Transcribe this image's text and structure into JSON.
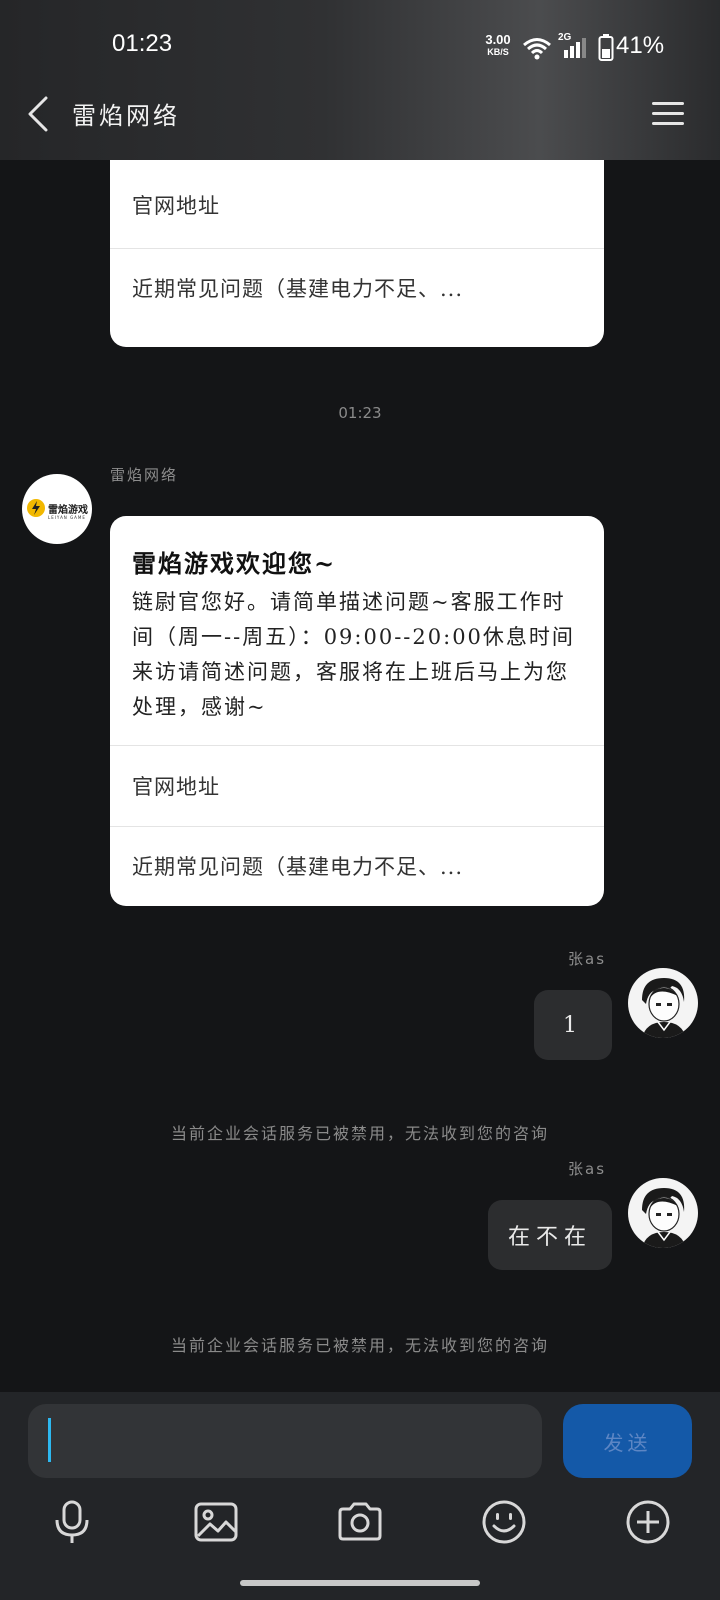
{
  "status_bar": {
    "time": "01:23",
    "net_speed": "3.00",
    "net_unit": "KB/S",
    "signal_label": "2G",
    "battery": "41%"
  },
  "header": {
    "title": "雷焰网络"
  },
  "chat": {
    "card_partial": {
      "link1": "官网地址",
      "link2": "近期常见问题（基建电力不足、..."
    },
    "timestamp": "01:23",
    "bot": {
      "name": "雷焰网络",
      "avatar_text": "雷焰游戏",
      "avatar_sub": "LEIYAN GAME",
      "card": {
        "heading": "雷焰游戏欢迎您~",
        "body": "链尉官您好。请简单描述问题~客服工作时间（周一--周五）：09:00--20:00休息时间来访请简述问题，客服将在上班后马上为您处理，感谢~",
        "link1": "官网地址",
        "link2": "近期常见问题（基建电力不足、..."
      }
    },
    "messages": [
      {
        "sender": "张as",
        "text": "1",
        "notice": "当前企业会话服务已被禁用，无法收到您的咨询"
      },
      {
        "sender": "张as",
        "text": "在不在",
        "notice": "当前企业会话服务已被禁用，无法收到您的咨询"
      }
    ]
  },
  "input": {
    "value": "",
    "send_label": "发送"
  },
  "toolbar": {
    "icons": [
      "microphone-icon",
      "image-icon",
      "camera-icon",
      "emoji-icon",
      "plus-icon"
    ]
  },
  "colors": {
    "background": "#141517",
    "send_button": "#1459a8",
    "cursor": "#2db8f0"
  }
}
